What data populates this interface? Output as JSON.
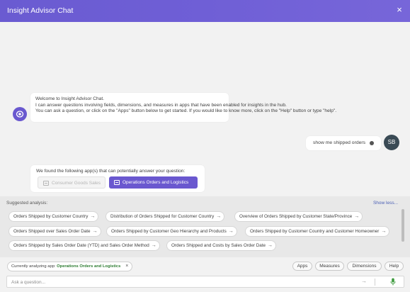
{
  "header": {
    "title": "Insight Advisor Chat",
    "close_glyph": "×"
  },
  "bot": {
    "avatar_icon": "insight-advisor-icon",
    "welcome_lines": [
      "Welcome to Insight Advisor Chat.",
      "I can answer questions involving fields, dimensions, and measures in apps that have been enabled for insights in the hub.",
      "You can ask a question, or click on the \"Apps\" button below to get started. If you would like to know more, click on the \"Help\" button or type \"help\"."
    ],
    "apps_label": "We found the following app(s) that can potentially answer your question:",
    "apps": [
      {
        "label": "Consumer Goods Sales",
        "state": "disabled"
      },
      {
        "label": "Operations Orders and Logistics",
        "state": "selected"
      }
    ]
  },
  "user": {
    "message": "show me shipped orders",
    "initials": "SB"
  },
  "suggested": {
    "label": "Suggested analysis:",
    "toggle": "Show less...",
    "chips": [
      "Orders Shipped by Customer Country",
      "Distribution of Orders Shipped for Customer Country",
      "Overview of Orders Shipped by Customer State/Province",
      "Orders Shipped over Sales Order Date",
      "Orders Shipped by Customer Geo Hierarchy and Products",
      "Orders Shipped by Customer Country and Customer Homeowner",
      "Orders Shipped by Sales Order Date (YTD) and Sales Order Method",
      "Orders Shipped and Costs by Sales Order Date"
    ]
  },
  "footer": {
    "analyzing_prefix": "Currently analyzing app:",
    "analyzing_app": "Operations Orders and Logistics",
    "buttons": [
      "Apps",
      "Measures",
      "Dimensions",
      "Help"
    ],
    "ask_placeholder": "Ask a question..."
  },
  "colors": {
    "accent": "#6a58cf",
    "header": "#6f5fd6",
    "app_name": "#2e7d32",
    "link": "#4a5fb5",
    "mic": "#3c9a3c"
  }
}
